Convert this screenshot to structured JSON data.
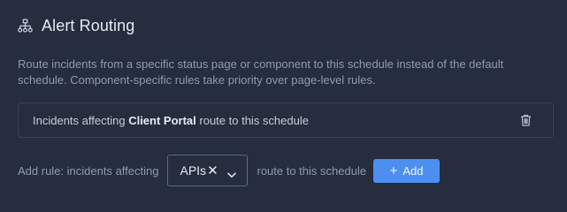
{
  "header": {
    "icon": "sitemap-icon",
    "title": "Alert Routing"
  },
  "description": "Route incidents from a specific status page or component to this schedule instead of the default schedule. Component-specific rules take priority over page-level rules.",
  "rules": [
    {
      "prefix": "Incidents affecting",
      "target": "Client Portal",
      "suffix": "route to this schedule",
      "delete_icon": "trash-icon"
    }
  ],
  "add_rule": {
    "label": "Add rule: incidents affecting",
    "selected_value": "APIs",
    "clear_glyph": "✕",
    "route_label": "route to this schedule",
    "button_label": "Add",
    "button_icon": "plus-icon"
  },
  "colors": {
    "background": "#252d3e",
    "accent": "#4d8ff0",
    "muted_text": "#8e9bb1",
    "border": "#3a4459"
  }
}
